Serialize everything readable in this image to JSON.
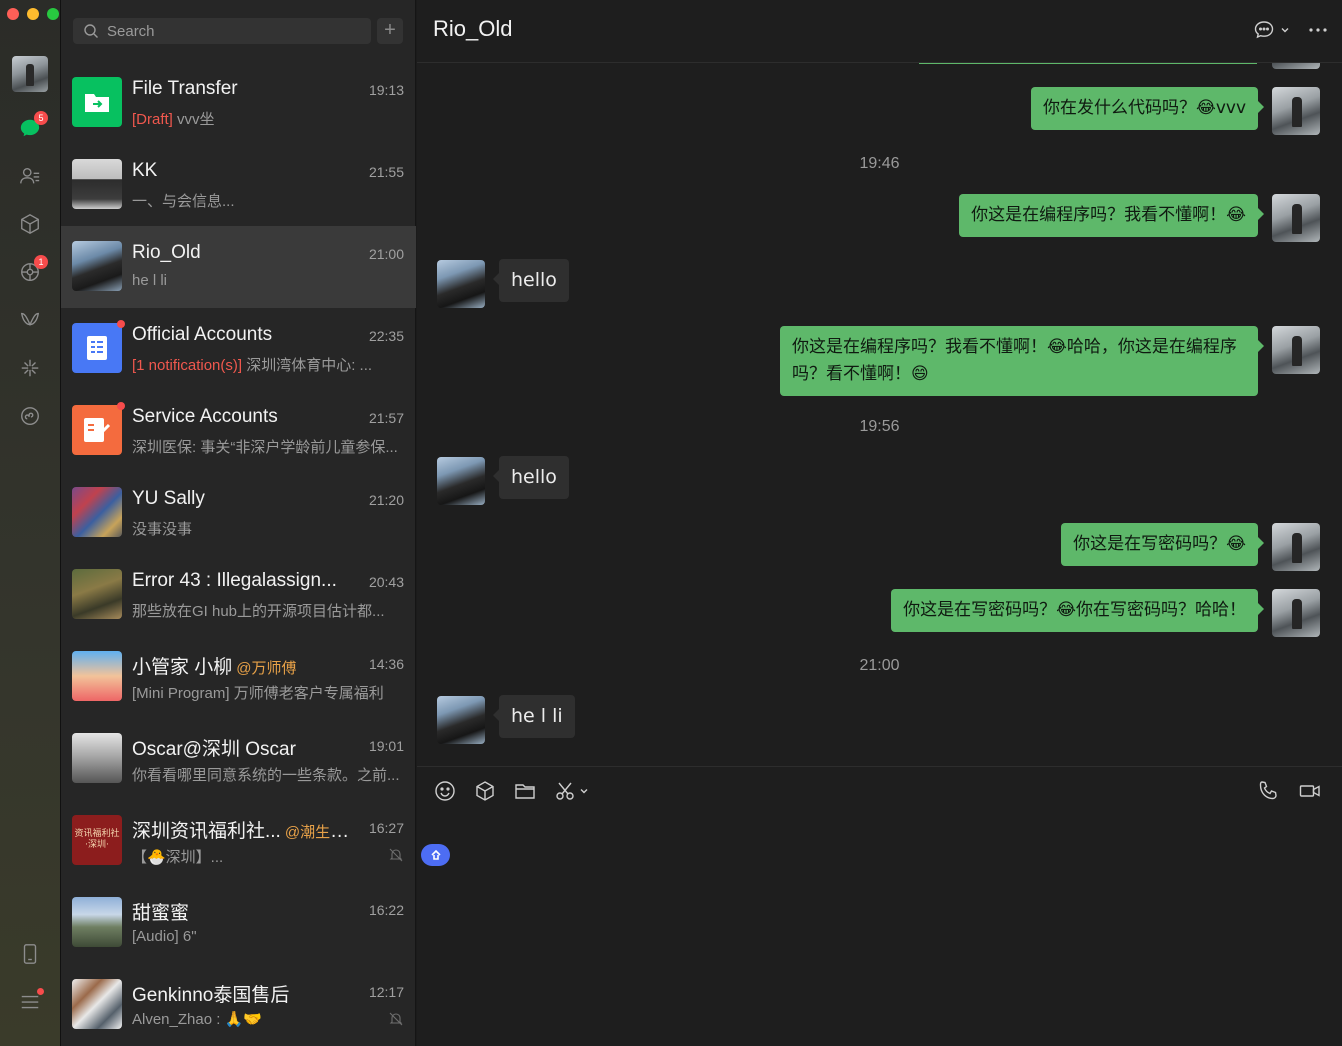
{
  "window": {
    "title": "Rio_Old"
  },
  "rail": {
    "chats_badge": "5",
    "moments_badge": "1"
  },
  "search": {
    "placeholder": "Search",
    "add_label": "+"
  },
  "conversations": [
    {
      "name": "File Transfer",
      "time": "19:13",
      "draft_tag": "[Draft]",
      "preview": " vvv坐"
    },
    {
      "name": "KK",
      "time": "21:55",
      "preview": "一、与会信息..."
    },
    {
      "name": "Rio_Old",
      "time": "21:00",
      "preview": "he l li"
    },
    {
      "name": "Official Accounts",
      "time": "22:35",
      "notify_tag": "[1 notification(s)]",
      "preview": " 深圳湾体育中心: ..."
    },
    {
      "name": "Service Accounts",
      "time": "21:57",
      "preview": "深圳医保: 事关“非深户学龄前儿童参保..."
    },
    {
      "name": "YU Sally",
      "time": "21:20",
      "preview": "没事没事"
    },
    {
      "name": "Error 43 : Illegalassign...",
      "time": "20:43",
      "preview": "那些放在GI hub上的开源项目估计都..."
    },
    {
      "name": "小管家 小柳",
      "mention": "@万师傅",
      "time": "14:36",
      "preview": "[Mini Program] 万师傅老客户专属福利"
    },
    {
      "name": "Oscar@深圳 Oscar",
      "time": "19:01",
      "preview": "你看看哪里同意系统的一些条款。之前..."
    },
    {
      "name": "深圳资讯福利社...",
      "mention": "@潮生活...",
      "time": "16:27",
      "preview": "【🐣深圳】..."
    },
    {
      "name": "甜蜜蜜",
      "time": "16:22",
      "preview": "[Audio] 6\""
    },
    {
      "name": "Genkinno泰国售后",
      "time": "12:17",
      "preview": "Alven_Zhao : 🙏🤝"
    }
  ],
  "avatar_text": {
    "shenzhen": "资讯福利社\n·深圳·"
  },
  "chat": {
    "title": "Rio_Old",
    "messages": [
      {
        "from": "me",
        "text": "你在发什么代码吗？😂vvv"
      },
      {
        "type": "time",
        "text": "19:46"
      },
      {
        "from": "me",
        "text": "你这是在编程序吗？我看不懂啊！😂"
      },
      {
        "from": "peer",
        "text": "hello"
      },
      {
        "from": "me",
        "text": "你这是在编程序吗？我看不懂啊！😂哈哈，你这是在编程序吗？看不懂啊！😄"
      },
      {
        "type": "time",
        "text": "19:56"
      },
      {
        "from": "peer",
        "text": "hello"
      },
      {
        "from": "me",
        "text": "你这是在写密码吗？😂"
      },
      {
        "from": "me",
        "text": "你这是在写密码吗？😂你在写密码吗？哈哈！"
      },
      {
        "type": "time",
        "text": "21:00"
      },
      {
        "from": "peer",
        "text": "he l li"
      }
    ]
  },
  "colors": {
    "accent": "#07c160",
    "bubble_me": "#5eb86a",
    "badge": "#f74c4c",
    "mention": "#e7a148"
  }
}
